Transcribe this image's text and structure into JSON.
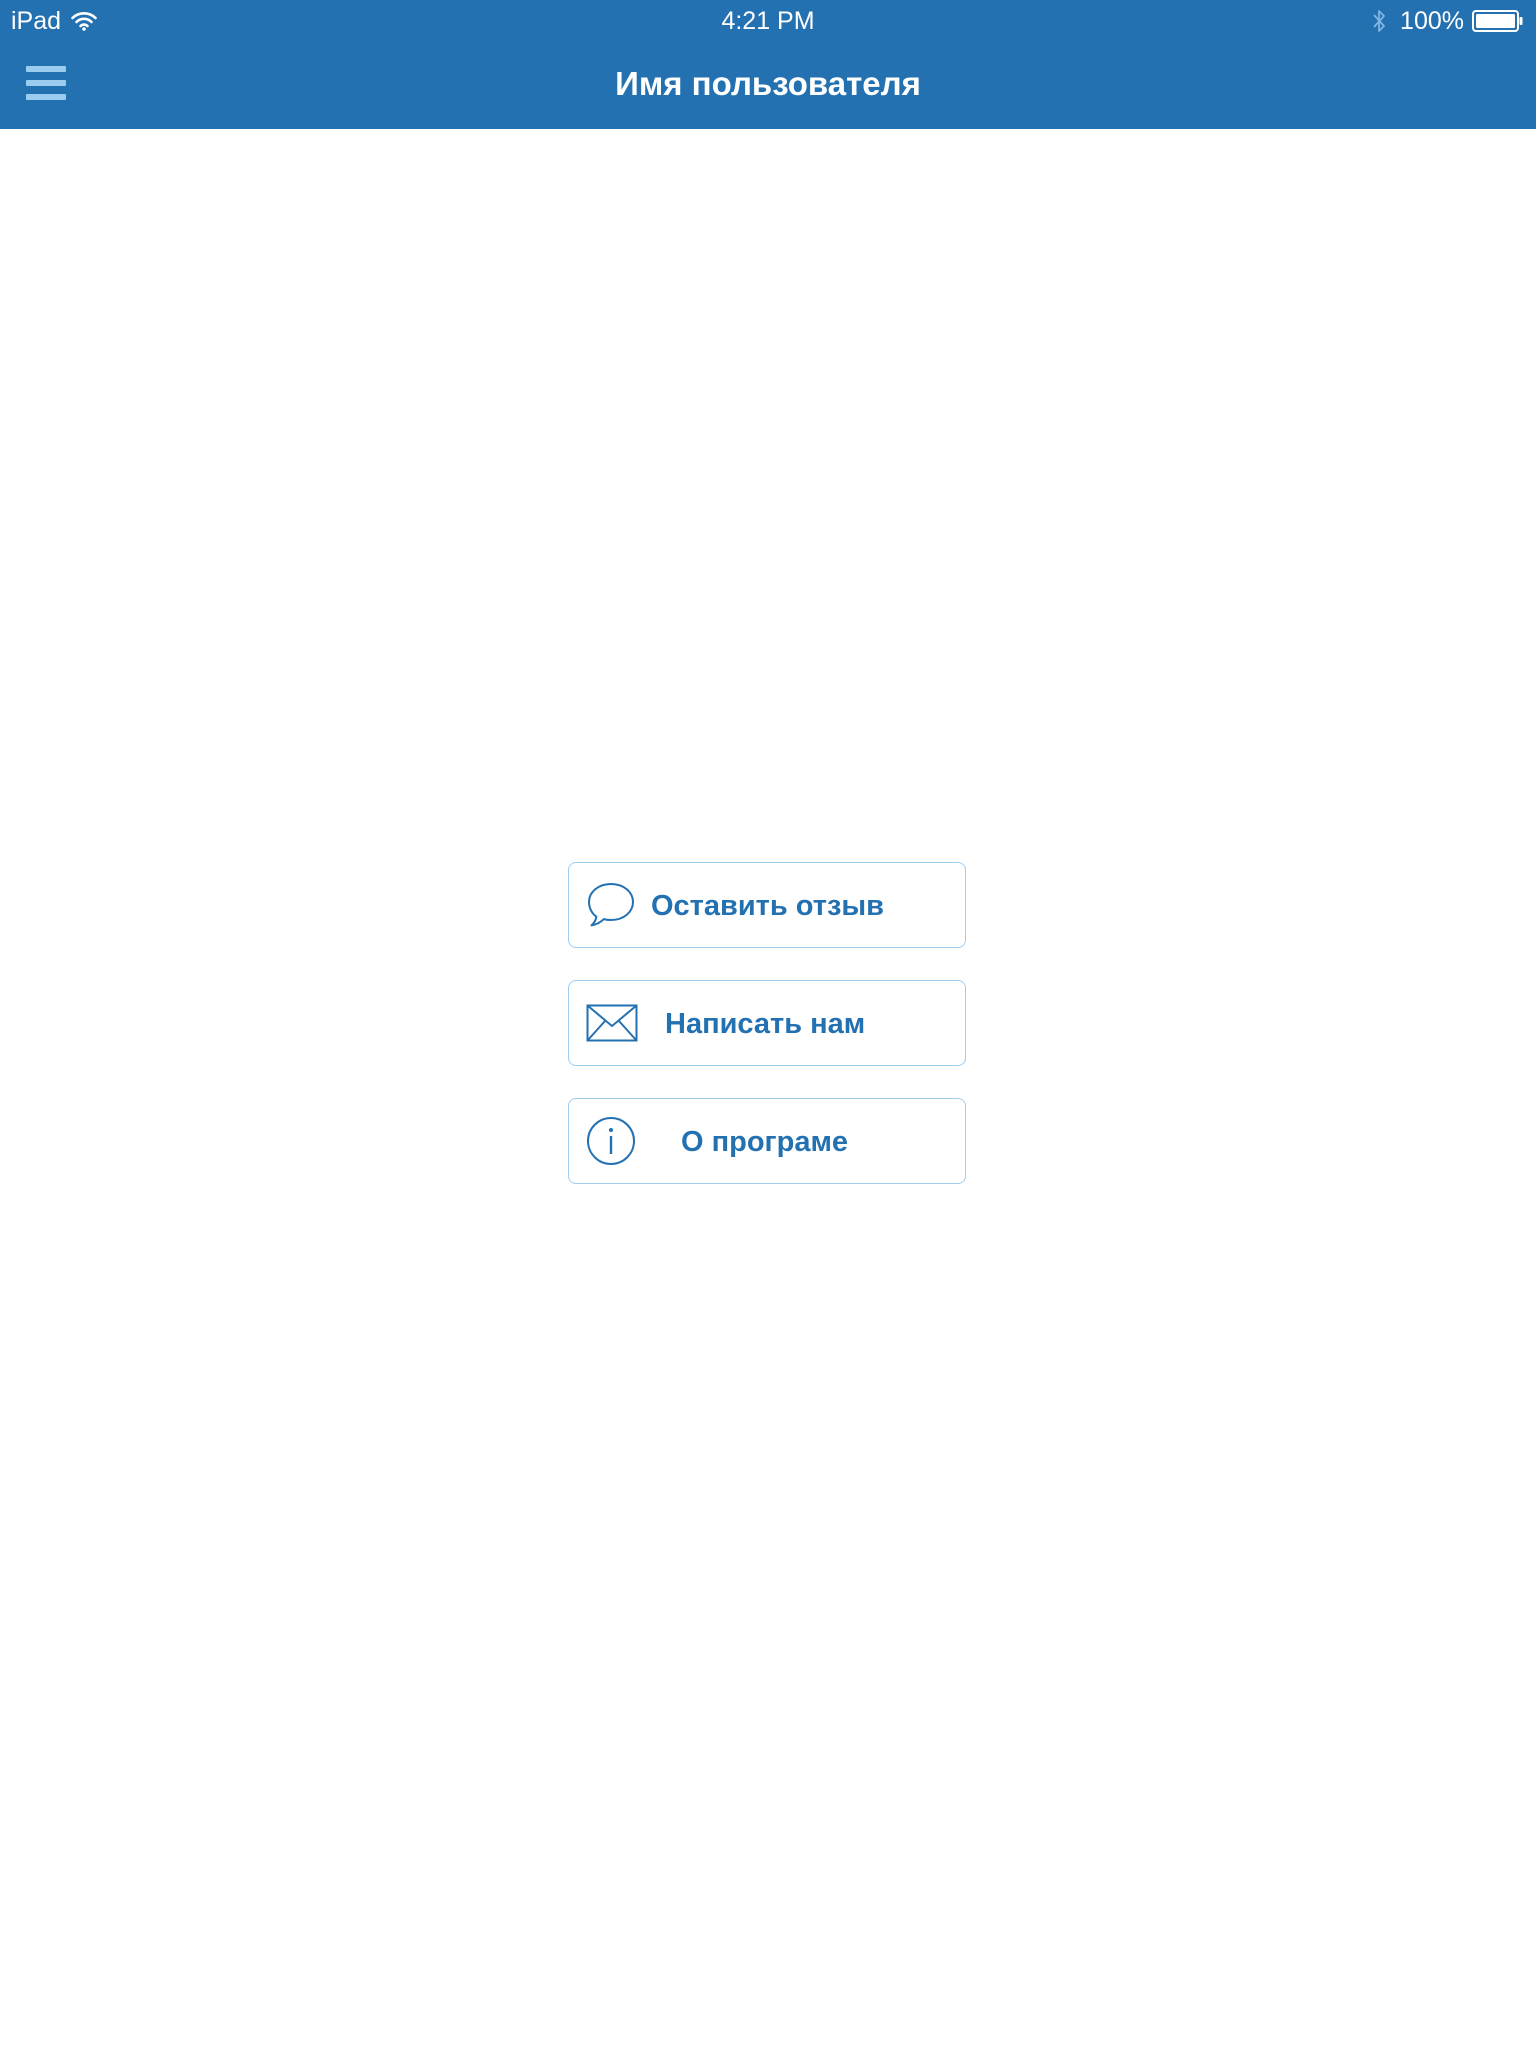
{
  "status_bar": {
    "device": "iPad",
    "time": "4:21 PM",
    "battery": "100%",
    "icons": [
      "wifi-icon",
      "bluetooth-icon",
      "battery-icon"
    ]
  },
  "nav_bar": {
    "title": "Имя пользователя",
    "menu_icon": "hamburger-menu-icon"
  },
  "actions": [
    {
      "label": "Оставить отзыв",
      "icon": "speech-bubble-icon"
    },
    {
      "label": "Написать нам",
      "icon": "envelope-icon"
    },
    {
      "label": "О програме",
      "icon": "info-icon"
    }
  ],
  "colors": {
    "nav_background": "#2471b2",
    "accent": "#2471b2",
    "button_border": "#9fcdee",
    "menu_icon": "#9ccbf0"
  }
}
